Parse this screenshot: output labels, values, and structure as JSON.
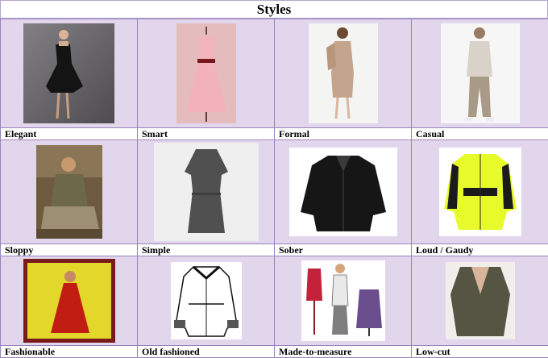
{
  "title": "Styles",
  "rows": [
    {
      "items": [
        {
          "label": "Elegant",
          "icon": "black-strapless-dress-photo"
        },
        {
          "label": "Smart",
          "icon": "pink-dress-on-mannequin-photo"
        },
        {
          "label": "Formal",
          "icon": "beige-suit-woman-photo"
        },
        {
          "label": "Casual",
          "icon": "casual-man-trench-coat-photo"
        }
      ]
    },
    {
      "items": [
        {
          "label": "Sloppy",
          "icon": "sloppy-woman-sitting-photo"
        },
        {
          "label": "Simple",
          "icon": "grey-simple-dress-photo"
        },
        {
          "label": "Sober",
          "icon": "black-leather-jacket-photo"
        },
        {
          "label": "Loud / Gaudy",
          "icon": "neon-yellow-jacket-photo"
        }
      ]
    },
    {
      "items": [
        {
          "label": "Fashionable",
          "icon": "red-dress-framed-photo"
        },
        {
          "label": "Old fashioned",
          "icon": "fur-trim-coat-sketch"
        },
        {
          "label": "Made-to-measure",
          "icon": "tailor-mannequins-illustration"
        },
        {
          "label": "Low-cut",
          "icon": "low-cut-top-photo"
        }
      ]
    }
  ]
}
